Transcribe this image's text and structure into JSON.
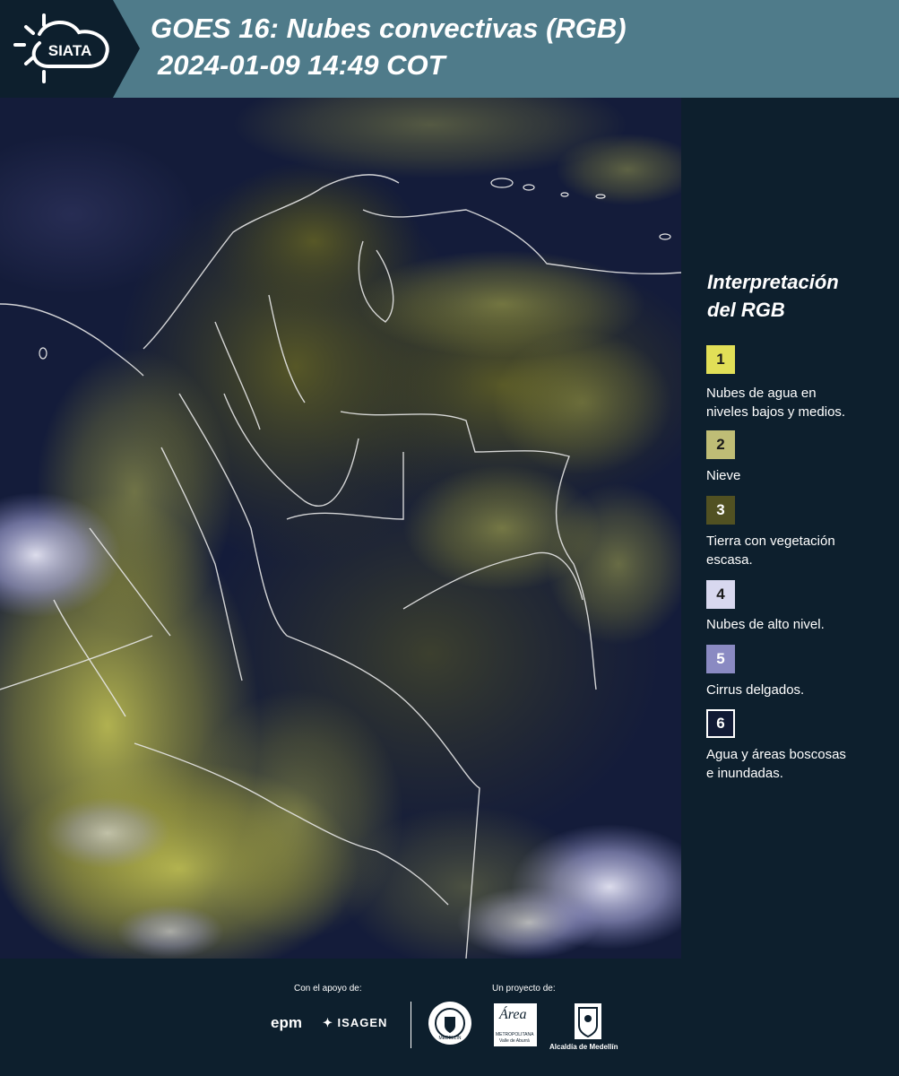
{
  "header": {
    "logo_text": "SIATA",
    "title_line1": "GOES 16: Nubes convectivas (RGB)",
    "title_line2": "2024-01-09 14:49 COT",
    "background": "#4f7b8a",
    "logo_background": "#0d1f2d"
  },
  "legend": {
    "title_line1": "Interpretación",
    "title_line2": "del RGB",
    "items": [
      {
        "number": "1",
        "label_line1": "Nubes de agua en",
        "label_line2": "niveles bajos y medios.",
        "color": "#e1df57"
      },
      {
        "number": "2",
        "label_line1": "Nieve",
        "label_line2": "",
        "color": "#bfbd76"
      },
      {
        "number": "3",
        "label_line1": "Tierra con vegetación",
        "label_line2": "escasa.",
        "color": "#515122"
      },
      {
        "number": "4",
        "label_line1": "Nubes de alto nivel.",
        "label_line2": "",
        "color": "#d8d8ef"
      },
      {
        "number": "5",
        "label_line1": "Cirrus delgados.",
        "label_line2": "",
        "color": "#8a8ac2"
      },
      {
        "number": "6",
        "label_line1": "Agua y áreas boscosas",
        "label_line2": "e inundadas.",
        "color": "#111a35"
      }
    ]
  },
  "footer": {
    "support_label": "Con el apoyo de:",
    "project_label": "Un proyecto de:",
    "sponsors": [
      "epm",
      "ISAGEN"
    ],
    "partners": [
      "MEDELLÍN",
      "Área",
      "METROPOLITANA",
      "Valle de Aburrá",
      "Alcaldía de Medellín"
    ]
  }
}
